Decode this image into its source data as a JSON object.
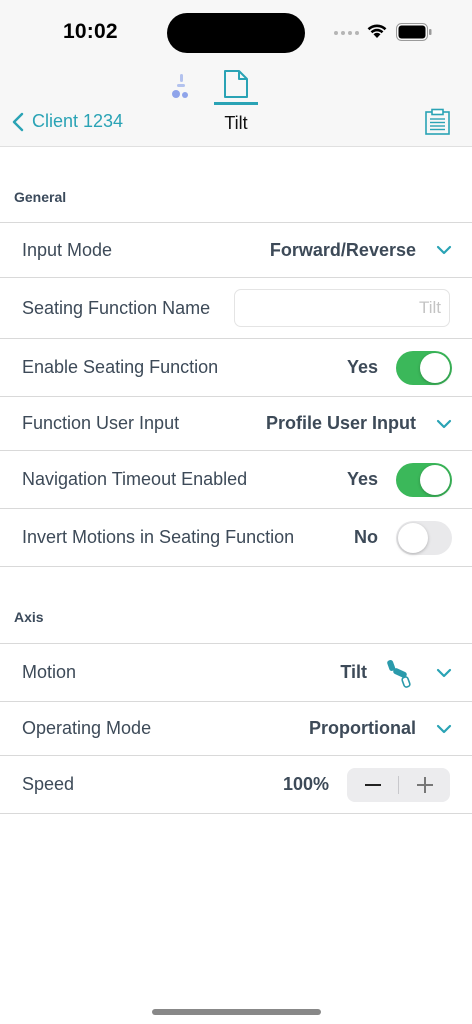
{
  "status": {
    "time": "10:02"
  },
  "nav": {
    "back_label": "Client 1234",
    "title": "Tilt",
    "active_segment": "document"
  },
  "general": {
    "header": "General",
    "input_mode": {
      "label": "Input Mode",
      "value": "Forward/Reverse"
    },
    "seating_function_name": {
      "label": "Seating Function Name",
      "value": "",
      "placeholder": "Tilt"
    },
    "enable_seating_function": {
      "label": "Enable Seating Function",
      "value": "Yes",
      "on": true
    },
    "function_user_input": {
      "label": "Function User Input",
      "value": "Profile User Input"
    },
    "navigation_timeout": {
      "label": "Navigation Timeout Enabled",
      "value": "Yes",
      "on": true
    },
    "invert_motions": {
      "label": "Invert Motions in Seating Function",
      "value": "No",
      "on": false
    }
  },
  "axis": {
    "header": "Axis",
    "motion": {
      "label": "Motion",
      "value": "Tilt",
      "icon": "tilt-actuator-icon"
    },
    "operating_mode": {
      "label": "Operating Mode",
      "value": "Proportional"
    },
    "speed": {
      "label": "Speed",
      "value": "100%"
    }
  },
  "colors": {
    "accent": "#2aa3b5",
    "toggle_on": "#3bb85a",
    "toggle_off": "#e9e9eb",
    "text": "#3d4a58"
  }
}
